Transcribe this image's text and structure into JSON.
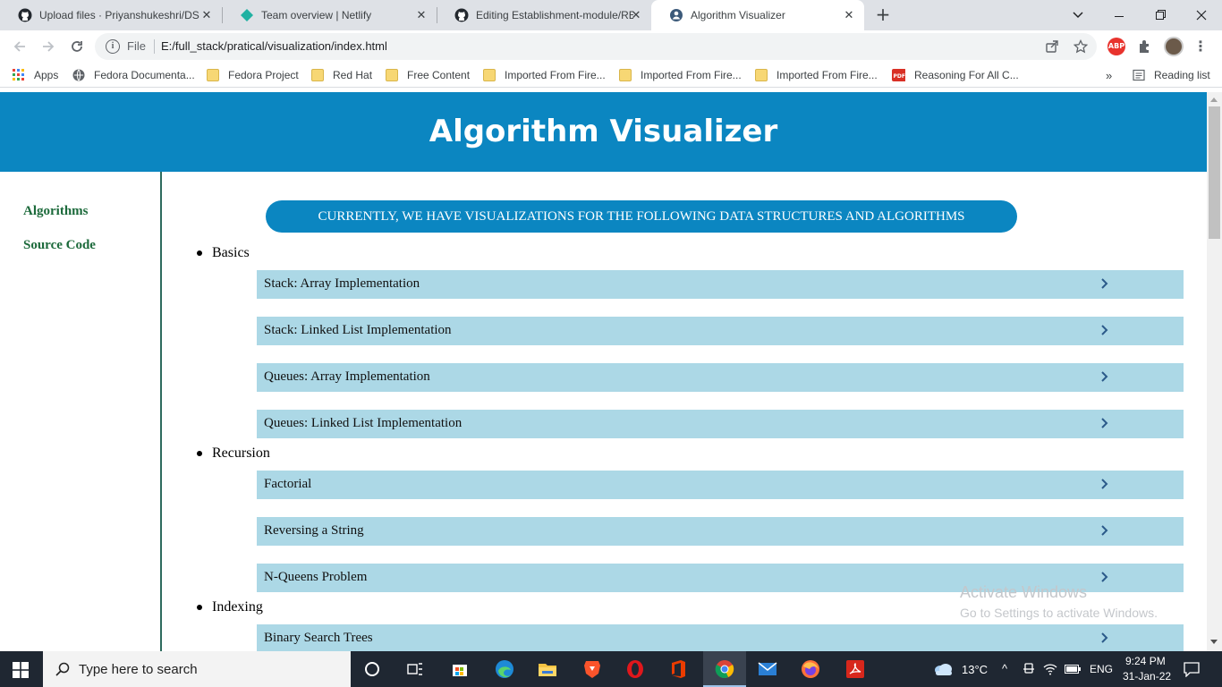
{
  "browser": {
    "tabs": [
      {
        "title": "Upload files · Priyanshukeshri/DS",
        "icon": "github-icon",
        "active": false
      },
      {
        "title": "Team overview | Netlify",
        "icon": "netlify-icon",
        "active": false
      },
      {
        "title": "Editing Establishment-module/RE",
        "icon": "github-icon",
        "active": false
      },
      {
        "title": "Algorithm Visualizer",
        "icon": "globe-icon",
        "active": true
      }
    ],
    "new_tab": "+",
    "omnibox": {
      "scheme_label": "File",
      "url": "E:/full_stack/pratical/visualization/index.html"
    },
    "bookmarks": [
      {
        "label": "Apps",
        "icon": "apps-grid-icon"
      },
      {
        "label": "Fedora Documenta...",
        "icon": "globe-icon"
      },
      {
        "label": "Fedora Project",
        "icon": "folder-icon"
      },
      {
        "label": "Red Hat",
        "icon": "folder-icon"
      },
      {
        "label": "Free Content",
        "icon": "folder-icon"
      },
      {
        "label": "Imported From Fire...",
        "icon": "folder-icon"
      },
      {
        "label": "Imported From Fire...",
        "icon": "folder-icon"
      },
      {
        "label": "Imported From Fire...",
        "icon": "folder-icon"
      },
      {
        "label": "Reasoning For All C...",
        "icon": "pdf-icon"
      }
    ],
    "bookmarks_overflow": "»",
    "reading_list": "Reading list",
    "extensions": {
      "abp": "ABP"
    }
  },
  "page": {
    "title": "Algorithm Visualizer",
    "sidebar": [
      {
        "label": "Algorithms"
      },
      {
        "label": "Source Code"
      }
    ],
    "banner": "CURRENTLY, WE HAVE VISUALIZATIONS FOR THE FOLLOWING DATA STRUCTURES AND ALGORITHMS",
    "categories": [
      {
        "name": "Basics",
        "items": [
          "Stack: Array Implementation",
          "Stack: Linked List Implementation",
          "Queues: Array Implementation",
          "Queues: Linked List Implementation"
        ]
      },
      {
        "name": "Recursion",
        "items": [
          "Factorial",
          "Reversing a String",
          "N-Queens Problem"
        ]
      },
      {
        "name": "Indexing",
        "items": [
          "Binary Search Trees"
        ]
      }
    ],
    "watermark": {
      "title": "Activate Windows",
      "subtitle": "Go to Settings to activate Windows."
    }
  },
  "taskbar": {
    "search_placeholder": "Type here to search",
    "weather": "13°C",
    "language": "ENG",
    "time": "9:24 PM",
    "date": "31-Jan-22"
  },
  "colors": {
    "header": "#0b86c1",
    "item_background": "#acd8e6",
    "sidebar_link": "#1c6a3b"
  }
}
